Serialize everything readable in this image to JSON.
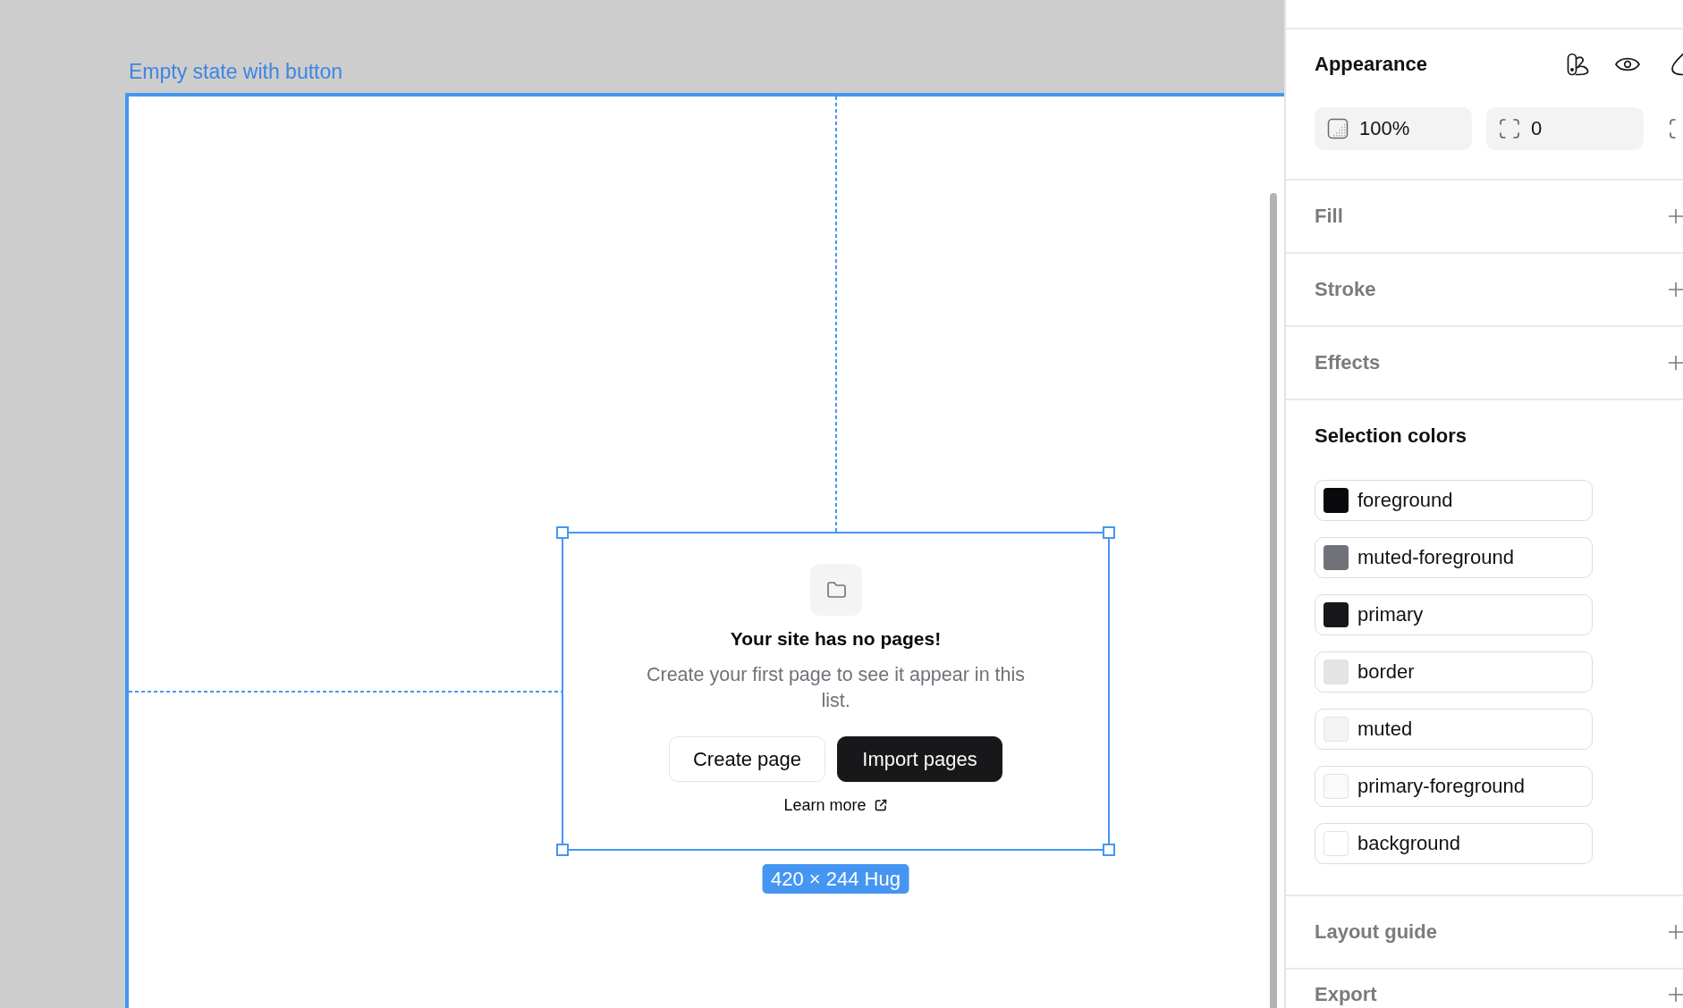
{
  "canvas": {
    "frame_label": "Empty state with button",
    "empty_state": {
      "title": "Your site has no pages!",
      "description": "Create your first page to see it appear in this list.",
      "buttons": [
        {
          "label": "Create page",
          "kind": "outline"
        },
        {
          "label": "Import pages",
          "kind": "solid"
        }
      ],
      "link": "Learn more"
    },
    "size_badge": "420 × 244 Hug"
  },
  "panel": {
    "sections": [
      {
        "kind": "appearance",
        "title": "Appearance",
        "fields": [
          {
            "kind": "opacity",
            "value": "100%"
          },
          {
            "kind": "radius",
            "value": "0"
          },
          {
            "kind": "corners"
          }
        ]
      },
      {
        "kind": "add",
        "title": "Fill"
      },
      {
        "kind": "add",
        "title": "Stroke"
      },
      {
        "kind": "add",
        "title": "Effects"
      },
      {
        "kind": "colors",
        "title": "Selection colors",
        "colors": [
          {
            "name": "foreground",
            "color": "#09090b"
          },
          {
            "name": "muted-foreground",
            "color": "#71717a"
          },
          {
            "name": "primary",
            "color": "#18181b"
          },
          {
            "name": "border",
            "color": "#e4e4e7"
          },
          {
            "name": "muted",
            "color": "#f4f4f5"
          },
          {
            "name": "primary-foreground",
            "color": "#fafafa"
          },
          {
            "name": "background",
            "color": "#ffffff"
          }
        ]
      },
      {
        "kind": "add",
        "title": "Layout guide"
      },
      {
        "kind": "add",
        "title": "Export"
      }
    ]
  }
}
